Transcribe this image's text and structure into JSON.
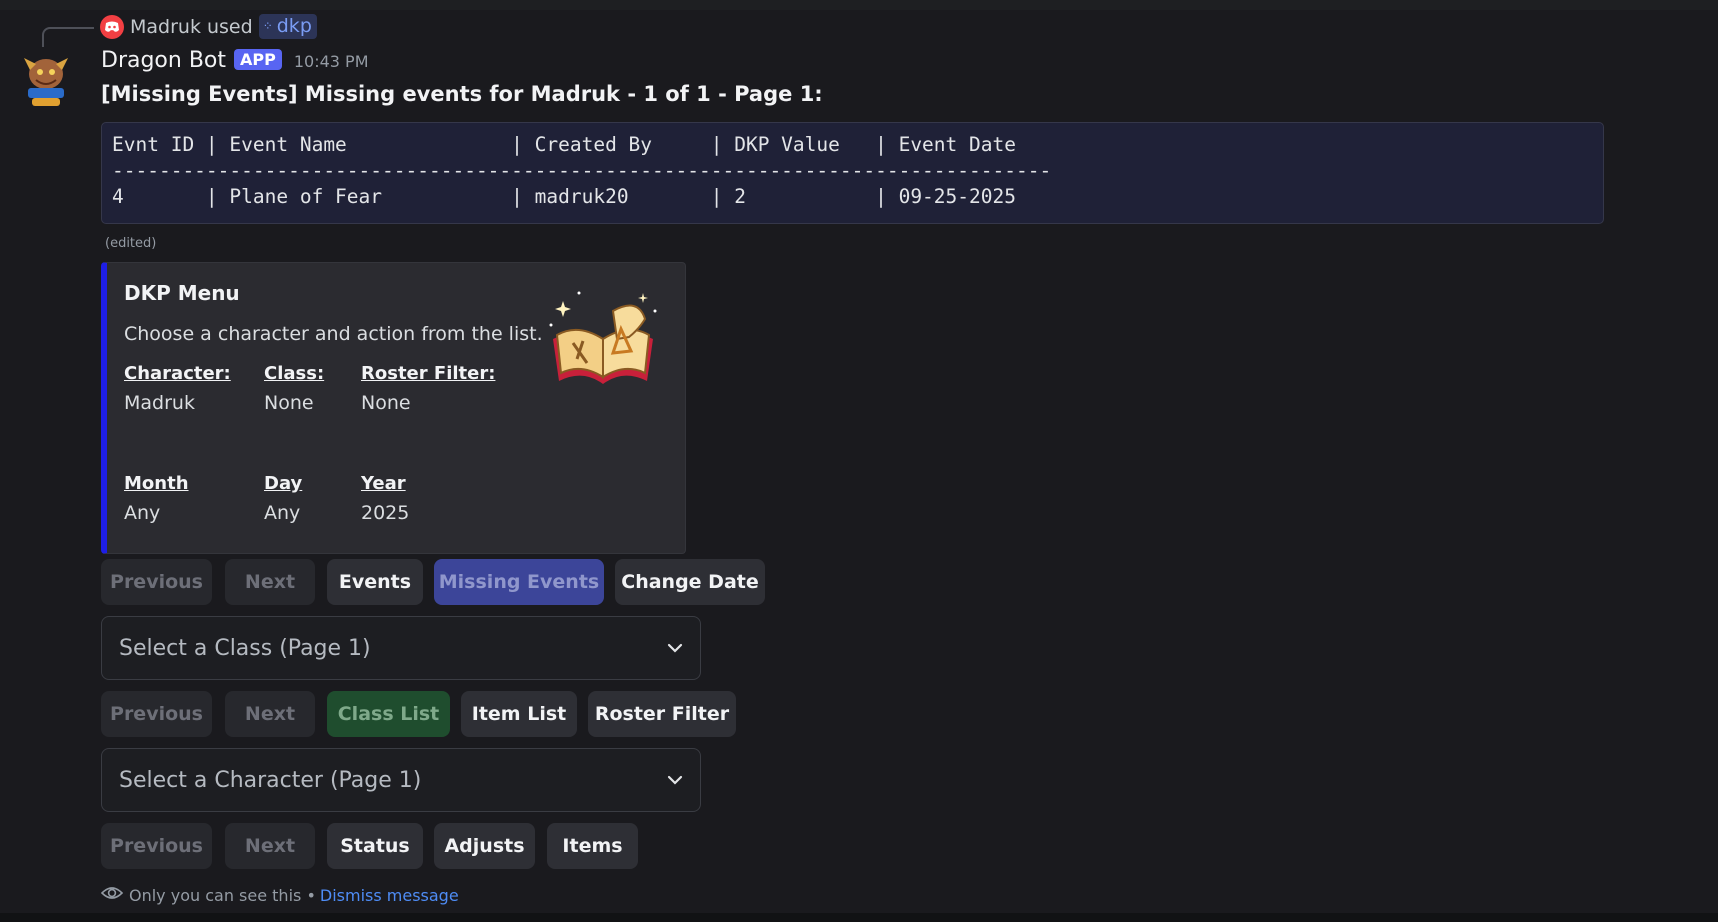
{
  "reply": {
    "user": "Madruk used",
    "command": "dkp"
  },
  "message": {
    "bot_name": "Dragon Bot",
    "badge": "APP",
    "timestamp": "10:43 PM",
    "title": "[Missing Events] Missing events for Madruk - 1 of 1 - Page 1:",
    "code_lines": [
      "Evnt ID | Event Name              | Created By     | DKP Value   | Event Date",
      "--------------------------------------------------------------------------------",
      "4       | Plane of Fear           | madruk20       | 2           | 09-25-2025"
    ],
    "edited": "(edited)"
  },
  "embed": {
    "title": "DKP Menu",
    "description": "Choose a character and action from the list.",
    "fields": [
      {
        "name": "Character:",
        "value": "Madruk"
      },
      {
        "name": "Class:",
        "value": "None"
      },
      {
        "name": "Roster Filter:",
        "value": "None"
      },
      {
        "name": "Month",
        "value": "Any"
      },
      {
        "name": "Day",
        "value": "Any"
      },
      {
        "name": "Year",
        "value": "2025"
      }
    ],
    "accent_color": "#1e1ee6"
  },
  "row1": {
    "previous": "Previous",
    "next": "Next",
    "events": "Events",
    "missing_events": "Missing Events",
    "change_date": "Change Date"
  },
  "select_class": {
    "placeholder": "Select a Class (Page 1)"
  },
  "row2": {
    "previous": "Previous",
    "next": "Next",
    "class_list": "Class List",
    "item_list": "Item List",
    "roster_filter": "Roster Filter"
  },
  "select_character": {
    "placeholder": "Select a Character (Page 1)"
  },
  "row3": {
    "previous": "Previous",
    "next": "Next",
    "status": "Status",
    "adjusts": "Adjusts",
    "items": "Items"
  },
  "footer": {
    "only_you": "Only you can see this •",
    "dismiss": "Dismiss message"
  },
  "icons": {
    "discord": "discord-icon",
    "command": "slash-command-icon",
    "eye": "eye-icon",
    "chevron": "chevron-down-icon",
    "thumbnail": "open-book-icon",
    "avatar": "dragon-bot-avatar"
  }
}
